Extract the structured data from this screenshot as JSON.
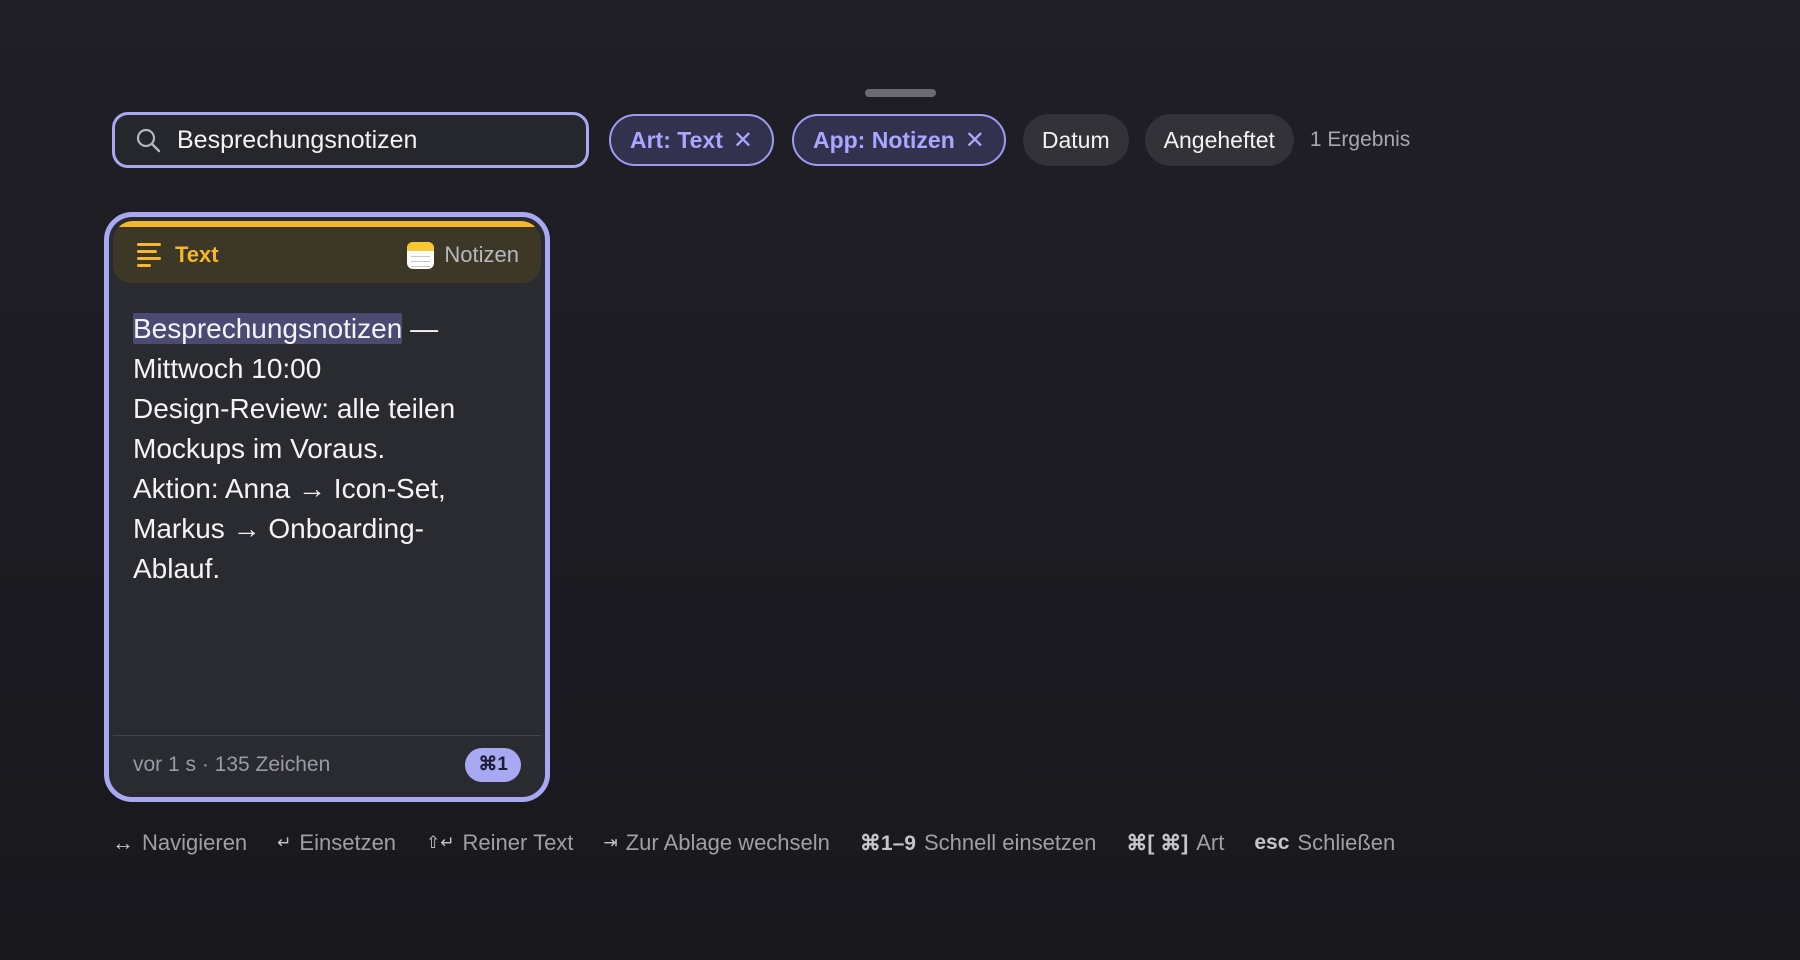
{
  "search": {
    "value": "Besprechungsnotizen",
    "icon": "magnifying-glass"
  },
  "filters": {
    "active": [
      {
        "label": "Art: Text",
        "remove": "✕"
      },
      {
        "label": "App: Notizen",
        "remove": "✕"
      }
    ],
    "inactive": [
      {
        "label": "Datum"
      },
      {
        "label": "Angeheftet"
      }
    ],
    "result_count": "1 Ergebnis"
  },
  "card": {
    "type_label": "Text",
    "type_icon": "text-lines",
    "app_label": "Notizen",
    "app_icon": "notes-app",
    "accent_color": "#f4b62b",
    "body": {
      "highlight": "Besprechungsnotizen",
      "after_highlight": " —",
      "lines": [
        "Mittwoch 10:00",
        "Design-Review: alle teilen",
        "Mockups im Voraus.",
        "Aktion: Anna → Icon-Set,",
        "Markus → Onboarding-",
        "Ablauf."
      ]
    },
    "meta": "vor 1 s · 135 Zeichen",
    "shortcut": "⌘1"
  },
  "hints": [
    {
      "key": "↔",
      "label": "Navigieren"
    },
    {
      "key": "↵",
      "label": "Einsetzen"
    },
    {
      "key": "⇧↵",
      "label": "Reiner Text"
    },
    {
      "key": "⇥",
      "label": "Zur Ablage wechseln"
    },
    {
      "key": "⌘1–9",
      "label": "Schnell einsetzen"
    },
    {
      "key": "⌘[ ⌘]",
      "label": "Art"
    },
    {
      "key": "esc",
      "label": "Schließen"
    }
  ],
  "colors": {
    "accent": "#a9a8f2",
    "background": "#1c1c22"
  }
}
